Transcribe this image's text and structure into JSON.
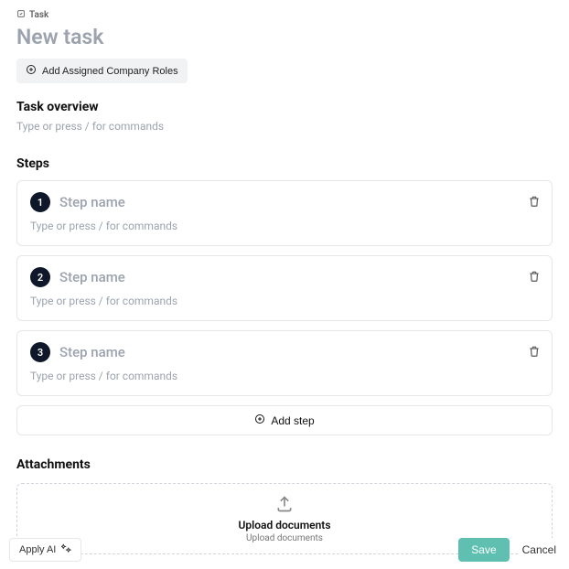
{
  "crumb": {
    "label": "Task"
  },
  "title": "New task",
  "add_roles": "Add Assigned Company Roles",
  "overview": {
    "heading": "Task overview",
    "placeholder": "Type or press / for commands"
  },
  "steps_heading": "Steps",
  "steps": [
    {
      "num": "1",
      "name_placeholder": "Step name",
      "body_placeholder": "Type or press / for commands"
    },
    {
      "num": "2",
      "name_placeholder": "Step name",
      "body_placeholder": "Type or press / for commands"
    },
    {
      "num": "3",
      "name_placeholder": "Step name",
      "body_placeholder": "Type or press / for commands"
    }
  ],
  "add_step": "Add step",
  "attachments": {
    "heading": "Attachments",
    "title": "Upload documents",
    "subtitle": "Upload documents"
  },
  "footer": {
    "apply_ai": "Apply AI",
    "save": "Save",
    "cancel": "Cancel"
  }
}
